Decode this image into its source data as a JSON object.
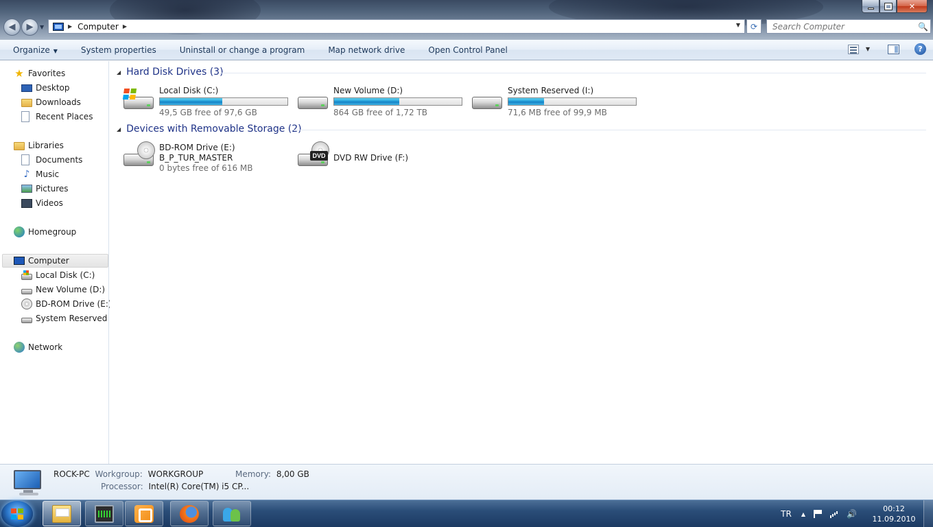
{
  "window": {
    "address_crumb": "Computer",
    "search_placeholder": "Search Computer"
  },
  "toolbar": {
    "organize": "Organize",
    "system_properties": "System properties",
    "uninstall": "Uninstall or change a program",
    "map_drive": "Map network drive",
    "control_panel": "Open Control Panel"
  },
  "nav": {
    "favorites": "Favorites",
    "desktop": "Desktop",
    "downloads": "Downloads",
    "recent_places": "Recent Places",
    "libraries": "Libraries",
    "documents": "Documents",
    "music": "Music",
    "pictures": "Pictures",
    "videos": "Videos",
    "homegroup": "Homegroup",
    "computer": "Computer",
    "local_disk": "Local Disk (C:)",
    "new_volume": "New Volume (D:)",
    "bdrom": "BD-ROM Drive (E:) B",
    "system_reserved": "System Reserved (I:)",
    "network": "Network"
  },
  "groups": {
    "hdd_title": "Hard Disk Drives (3)",
    "removable_title": "Devices with Removable Storage (2)"
  },
  "drives": [
    {
      "name": "Local Disk (C:)",
      "free_text": "49,5 GB free of 97,6 GB",
      "used_fraction": 0.49
    },
    {
      "name": "New Volume (D:)",
      "free_text": "864 GB free of 1,72 TB",
      "used_fraction": 0.51
    },
    {
      "name": "System Reserved (I:)",
      "free_text": "71,6 MB free of 99,9 MB",
      "used_fraction": 0.28
    }
  ],
  "removable": [
    {
      "name": "BD-ROM Drive (E:)",
      "label": "B_P_TUR_MASTER",
      "free_text": "0 bytes free of 616 MB"
    },
    {
      "name": "DVD RW Drive (F:)",
      "badge": "DVD"
    }
  ],
  "details": {
    "pc_name": "ROCK-PC",
    "workgroup_label": "Workgroup:",
    "workgroup_value": "WORKGROUP",
    "memory_label": "Memory:",
    "memory_value": "8,00 GB",
    "processor_label": "Processor:",
    "processor_value": "Intel(R) Core(TM) i5 CP..."
  },
  "tray": {
    "lang": "TR",
    "time": "00:12",
    "date": "11.09.2010"
  },
  "colors": {
    "bar_fill": "#26a0da",
    "group_title": "#1e3287",
    "taskbar": "#1c3a62"
  }
}
